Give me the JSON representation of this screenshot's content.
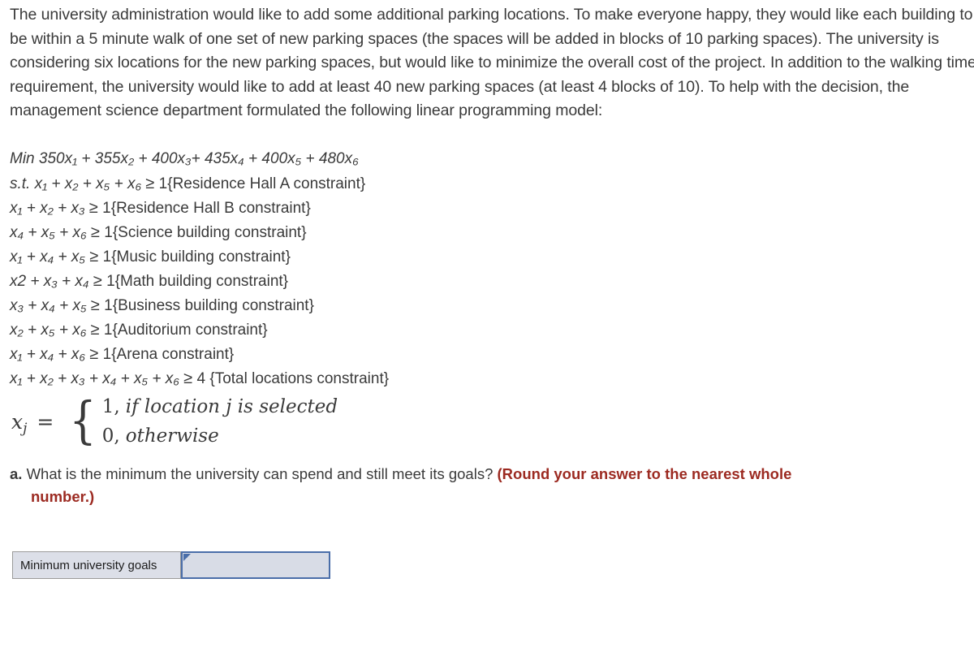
{
  "problem": {
    "intro": "The university administration would like to add some additional parking locations. To make everyone happy, they would like each building to be within a 5 minute walk of one set of new parking spaces (the spaces will be added in blocks of 10 parking spaces). The university is considering six locations for the new parking spaces, but would like to minimize the overall cost of the project. In addition to the walking time requirement, the university would like to add at least 40 new parking spaces (at least 4 blocks of 10). To help with the decision, the management science department formulated the following linear programming model:"
  },
  "model": {
    "objective": {
      "prefix": "Min",
      "terms": "350x₁ + 355x₂ + 400x₃+ 435x₄ + 400x₅ + 480x₆",
      "coefficients": [
        350,
        355,
        400,
        435,
        400,
        480
      ],
      "variables": [
        "x1",
        "x2",
        "x3",
        "x4",
        "x5",
        "x6"
      ]
    },
    "constraints": [
      {
        "prefix": "s.t.",
        "lhs": "x₁ + x₂ + x₅ + x₆",
        "op": "≥",
        "rhs": "1",
        "name": "{Residence Hall A constraint}"
      },
      {
        "prefix": "",
        "lhs": "x₁ + x₂ + x₃",
        "op": "≥",
        "rhs": "1",
        "name": "{Residence Hall B constraint}"
      },
      {
        "prefix": "",
        "lhs": "x₄ + x₅ + x₆",
        "op": "≥",
        "rhs": "1",
        "name": "{Science building constraint}"
      },
      {
        "prefix": "",
        "lhs": "x₁ + x₄ + x₅",
        "op": "≥",
        "rhs": "1",
        "name": "{Music building constraint}"
      },
      {
        "prefix": "",
        "lhs": "x2 + x₃ + x₄",
        "op": "≥",
        "rhs": "1",
        "name": "{Math building constraint}"
      },
      {
        "prefix": "",
        "lhs": "x₃ + x₄ + x₅",
        "op": "≥",
        "rhs": "1",
        "name": "{Business building constraint}"
      },
      {
        "prefix": "",
        "lhs": "x₂ + x₅ + x₆",
        "op": "≥",
        "rhs": "1",
        "name": "{Auditorium constraint}"
      },
      {
        "prefix": "",
        "lhs": "x₁ + x₄ + x₆",
        "op": "≥",
        "rhs": "1",
        "name": "{Arena constraint}"
      },
      {
        "prefix": "",
        "lhs": "x₁ + x₂ + x₃ + x₄ + x₅ + x₆",
        "op": "≥",
        "rhs": "4",
        "name": "{Total locations constraint}"
      }
    ],
    "piecewise": {
      "lhs_var": "x",
      "lhs_sub": "j",
      "equals": "=",
      "brace": "{",
      "case1_value": "1,",
      "case1_text": "if location j is selected",
      "case2_value": "0,",
      "case2_text": "otherwise"
    }
  },
  "question": {
    "label": "a.",
    "text": "What is the minimum the university can spend and still meet its goals?",
    "hint_line1": "(Round your answer to the nearest whole",
    "hint_line2": "number.)"
  },
  "answer": {
    "row_label": "Minimum university goals",
    "input_value": "",
    "input_placeholder": ""
  },
  "colors": {
    "text": "#3a3a3a",
    "hint_red": "#9c2a21",
    "input_border_blue": "#4a6ea9",
    "cell_fill": "#dcdfe8",
    "table_border": "#9a9a9a"
  }
}
